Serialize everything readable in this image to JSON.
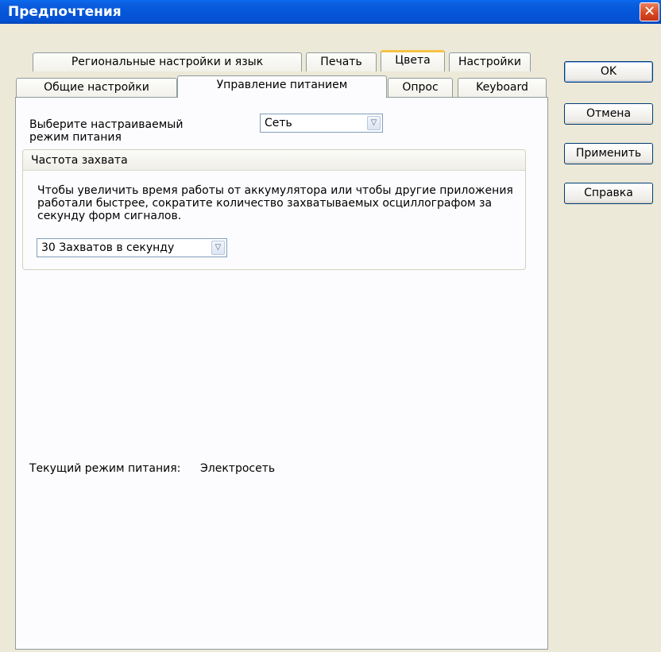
{
  "window": {
    "title": "Предпочтения",
    "close_glyph": "✕"
  },
  "tabs": {
    "row1": [
      "Региональные настройки и язык",
      "Печать",
      "Цвета",
      "Настройки"
    ],
    "row2": [
      "Общие настройки",
      "Управление питанием",
      "Опрос",
      "Keyboard"
    ],
    "active": "Управление питанием",
    "highlighted": "Цвета"
  },
  "buttons": {
    "ok": "OK",
    "cancel": "Отмена",
    "apply": "Применить",
    "help": "Справка"
  },
  "power_tab": {
    "mode_label": "Выберите настраиваемый режим питания",
    "mode_value": "Сеть",
    "group_title": "Частота захвата",
    "description": "Чтобы увеличить время работы от аккумулятора или чтобы другие приложения работали быстрее, сократите количество захватываемых осциллографом за секунду форм сигналов.",
    "rate_value": "30 Захватов в секунду",
    "current_label": "Текущий режим питания:",
    "current_value": "Электросеть"
  },
  "icons": {
    "dropdown_arrow": "chevron-down-icon",
    "close": "close-icon"
  },
  "colors": {
    "titlebar": "#0556d8",
    "dialog_bg": "#ece9d8",
    "tab_highlight": "#f7c246",
    "close_button": "#d6471f"
  }
}
